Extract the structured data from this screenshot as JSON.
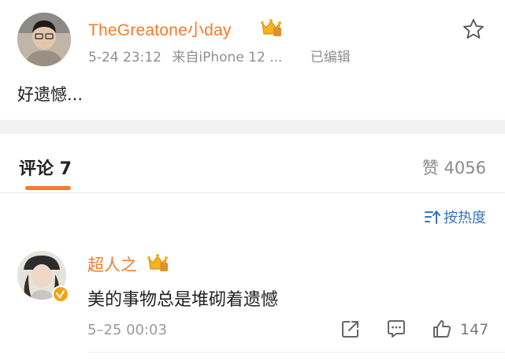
{
  "post": {
    "author": "TheGreatone小day",
    "time": "5-24 23:12",
    "source": "来自iPhone 12 ...",
    "edited": "已编辑",
    "text": "好遗憾..."
  },
  "tabs": {
    "comments": "评论 7",
    "likes": "赞 4056"
  },
  "sort": {
    "label": "按热度"
  },
  "comment": {
    "author": "超人之",
    "text": "美的事物总是堆砌着遗憾",
    "time": "5–25 00:03",
    "like_count": "147"
  },
  "colors": {
    "accent": "#f27b2c",
    "link": "#3a74b8",
    "verified": "#f2a414"
  }
}
